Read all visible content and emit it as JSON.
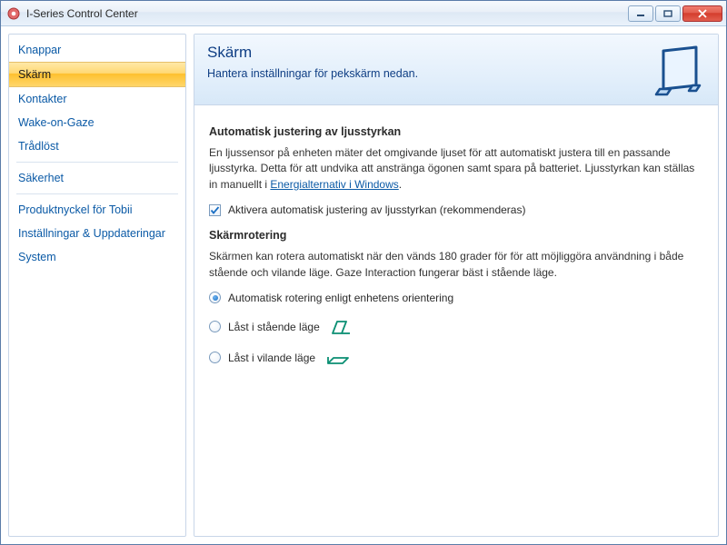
{
  "window": {
    "title": "I-Series Control Center"
  },
  "sidebar": {
    "items": [
      {
        "label": "Knappar",
        "selected": false
      },
      {
        "label": "Skärm",
        "selected": true
      },
      {
        "label": "Kontakter",
        "selected": false
      },
      {
        "label": "Wake-on-Gaze",
        "selected": false
      },
      {
        "label": "Trådlöst",
        "selected": false
      }
    ],
    "group2": [
      {
        "label": "Säkerhet"
      }
    ],
    "group3": [
      {
        "label": "Produktnyckel för Tobii"
      },
      {
        "label": "Inställningar & Uppdateringar"
      },
      {
        "label": "System"
      }
    ]
  },
  "header": {
    "title": "Skärm",
    "subtitle": "Hantera inställningar för pekskärm nedan."
  },
  "brightness": {
    "title": "Automatisk justering av ljusstyrkan",
    "text_before_link": "En ljussensor på enheten mäter det omgivande ljuset för att automatiskt justera till en passande ljusstyrka. Detta för att undvika att anstränga ögonen samt spara på batteriet. Ljusstyrkan kan ställas in manuellt i ",
    "link": "Energialternativ i Windows",
    "text_after_link": ".",
    "checkbox_label": "Aktivera automatisk justering av ljusstyrkan (rekommenderas)",
    "checked": true
  },
  "rotation": {
    "title": "Skärmrotering",
    "text": "Skärmen kan rotera automatiskt när den vänds 180 grader för för att möjliggöra användning i både stående och vilande läge. Gaze Interaction fungerar bäst i stående läge.",
    "options": [
      {
        "label": "Automatisk rotering enligt enhetens orientering",
        "checked": true,
        "icon": null
      },
      {
        "label": "Låst i stående läge",
        "checked": false,
        "icon": "portrait"
      },
      {
        "label": "Låst i vilande läge",
        "checked": false,
        "icon": "landscape"
      }
    ]
  }
}
